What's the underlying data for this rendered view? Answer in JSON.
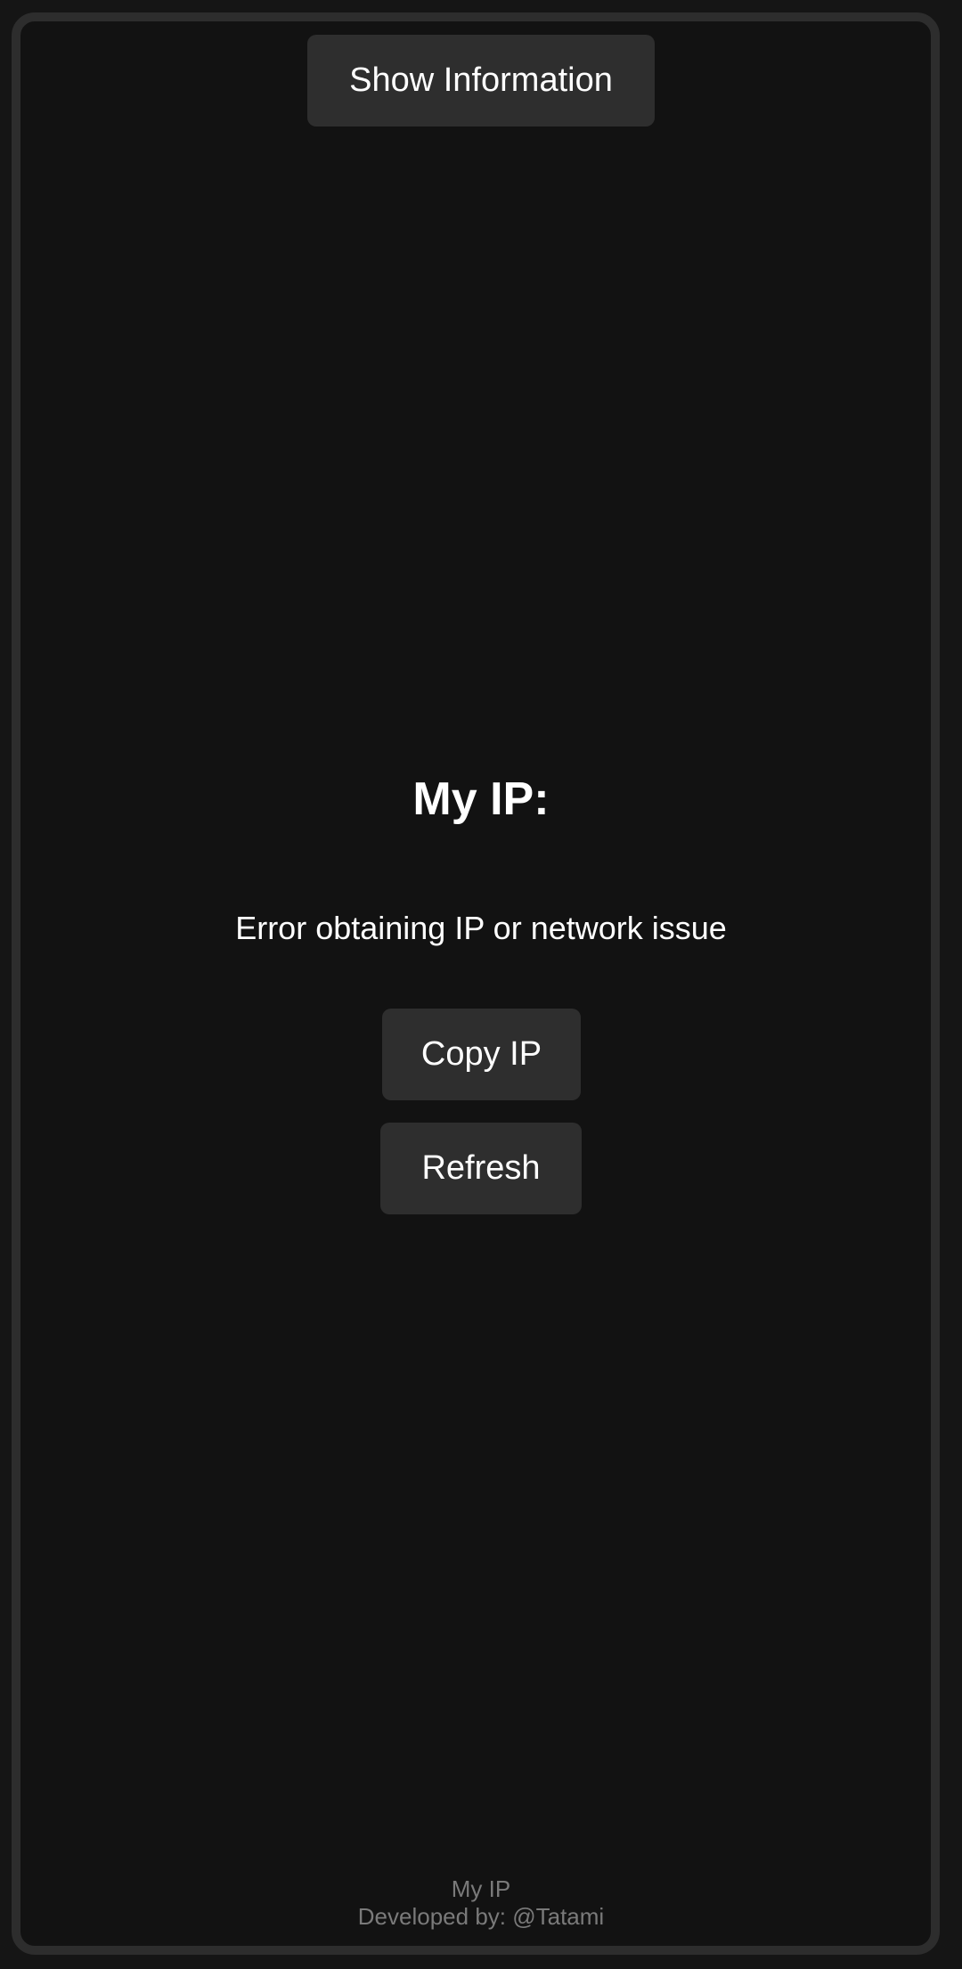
{
  "header": {
    "show_info_label": "Show Information"
  },
  "main": {
    "title": "My IP:",
    "status": "Error obtaining IP or network issue",
    "copy_label": "Copy IP",
    "refresh_label": "Refresh"
  },
  "footer": {
    "app_name": "My IP",
    "developer": "Developed by: @Tatami"
  },
  "colors": {
    "background": "#121212",
    "frame_border": "#2d2d2d",
    "button_bg": "#2e2e2e",
    "text": "#ffffff",
    "footer_text": "#7a7a7a"
  }
}
